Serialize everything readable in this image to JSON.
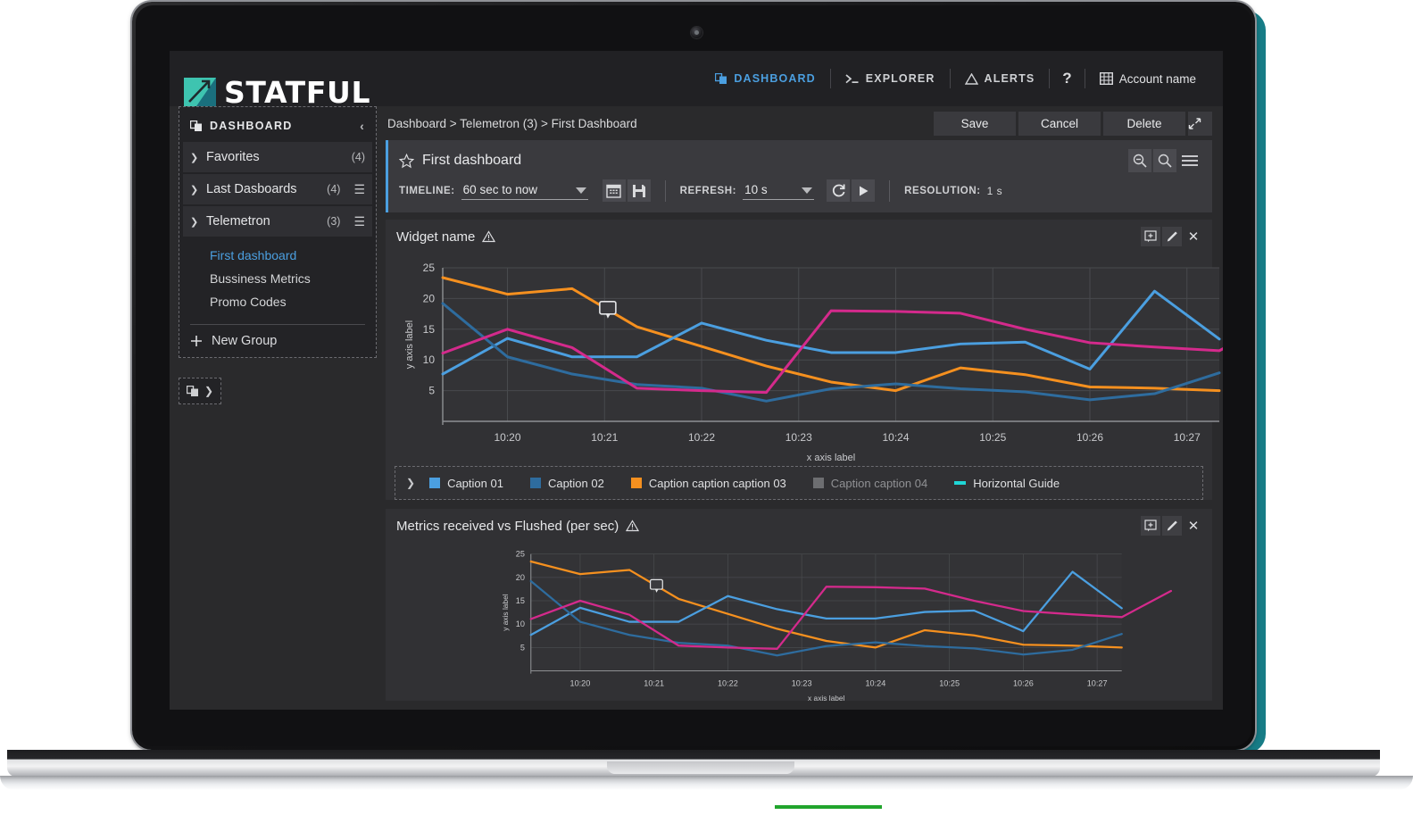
{
  "brand": {
    "name": "STATFUL"
  },
  "topnav": {
    "items": [
      {
        "label": "DASHBOARD",
        "icon": "dashboard-icon",
        "active": true
      },
      {
        "label": "EXPLORER",
        "icon": "terminal-icon",
        "active": false
      },
      {
        "label": "ALERTS",
        "icon": "warning-triangle-icon",
        "active": false
      }
    ],
    "help_label": "?",
    "account_label": "Account name",
    "account_icon": "building-icon"
  },
  "sidebar": {
    "header": "DASHBOARD",
    "header_icon": "dashboard-icon",
    "collapse_icon": "chevron-left-icon",
    "groups": [
      {
        "label": "Favorites",
        "count": "(4)",
        "expanded": false,
        "has_menu": false
      },
      {
        "label": "Last Dasboards",
        "count": "(4)",
        "expanded": false,
        "has_menu": true
      },
      {
        "label": "Telemetron",
        "count": "(3)",
        "expanded": true,
        "has_menu": true
      }
    ],
    "children": [
      {
        "label": "First dashboard",
        "selected": true
      },
      {
        "label": "Bussiness Metrics",
        "selected": false
      },
      {
        "label": "Promo Codes",
        "selected": false
      }
    ],
    "new_group_label": "New Group",
    "expand_panel_icon": "dashboard-icon"
  },
  "breadcrumb": "Dashboard > Telemetron (3) > First Dashboard",
  "actions": {
    "save_label": "Save",
    "cancel_label": "Cancel",
    "delete_label": "Delete",
    "expand_icon": "expand-arrow-icon"
  },
  "dashboard": {
    "title": "First dashboard",
    "star_icon": "star-outline-icon",
    "timeline_label": "TIMELINE:",
    "timeline_value": "60 sec to now",
    "calendar_icon": "calendar-icon",
    "save_view_icon": "floppy-disk-icon",
    "refresh_label": "REFRESH:",
    "refresh_value": "10 s",
    "reload_icon": "reload-icon",
    "play_icon": "play-icon",
    "resolution_label": "RESOLUTION:",
    "resolution_value": "1 s",
    "zoom_out_icon": "zoom-out-icon",
    "zoom_in_icon": "zoom-in-icon",
    "menu_icon": "hamburger-menu-icon"
  },
  "widgets": [
    {
      "title": "Widget name",
      "warning_icon": "warning-triangle-icon",
      "add_icon": "add-annotation-icon",
      "edit_icon": "pencil-icon",
      "close_icon": "close-icon",
      "has_legend": true
    },
    {
      "title": "Metrics received vs Flushed (per sec)",
      "warning_icon": "warning-triangle-icon",
      "add_icon": "add-annotation-icon",
      "edit_icon": "pencil-icon",
      "close_icon": "close-icon",
      "has_legend": false
    }
  ],
  "legend": {
    "collapse_icon": "chevron-down-icon",
    "items": [
      {
        "label": "Caption 01",
        "color": "#4b9fe0",
        "kind": "box",
        "disabled": false
      },
      {
        "label": "Caption 02",
        "color": "#2e6c9e",
        "kind": "box",
        "disabled": false
      },
      {
        "label": "Caption caption caption 03",
        "color": "#f5901f",
        "kind": "box",
        "disabled": false
      },
      {
        "label": "Caption caption 04",
        "color": "#6d6e71",
        "kind": "box",
        "disabled": true
      },
      {
        "label": "Horizontal Guide",
        "color": "#1fd6d6",
        "kind": "dash",
        "disabled": false
      }
    ]
  },
  "chart_data": {
    "type": "line",
    "title": "Widget name",
    "xlabel": "x axis label",
    "ylabel": "y axis label",
    "x": [
      "10:20",
      "10:21",
      "10:22",
      "10:23",
      "10:24",
      "10:25",
      "10:26",
      "10:27"
    ],
    "xlim": [
      0,
      9
    ],
    "ylim": [
      0,
      25
    ],
    "yticks": [
      5,
      10,
      15,
      20,
      25
    ],
    "grid": true,
    "legend_position": "bottom",
    "annotation": {
      "icon": "comment-marker-icon",
      "x_index": 2.55,
      "y_value": 18.2
    },
    "series": [
      {
        "name": "Caption caption caption 03",
        "color": "#f5901f",
        "values": [
          23.4,
          20.7,
          21.6,
          15.4,
          12.2,
          9.0,
          6.4,
          5.0,
          8.7,
          7.6,
          5.6,
          5.4,
          5.0
        ]
      },
      {
        "name": "Caption 01",
        "color": "#4b9fe0",
        "values": [
          7.7,
          13.5,
          10.5,
          10.5,
          16.0,
          13.2,
          11.2,
          11.2,
          12.6,
          12.9,
          8.5,
          21.2,
          13.4
        ]
      },
      {
        "name": "Caption 02",
        "color": "#2e6c9e",
        "values": [
          19.2,
          10.5,
          7.7,
          6.0,
          5.4,
          3.3,
          5.3,
          6.1,
          5.3,
          4.8,
          3.5,
          4.5,
          7.9
        ]
      },
      {
        "name": "Caption caption 04",
        "color": "#d42a8c",
        "values": [
          11.1,
          15.0,
          12.0,
          5.4,
          5.0,
          4.7,
          18.0,
          17.9,
          17.6,
          15.0,
          12.8,
          12.1,
          11.5,
          17.1
        ]
      }
    ]
  }
}
